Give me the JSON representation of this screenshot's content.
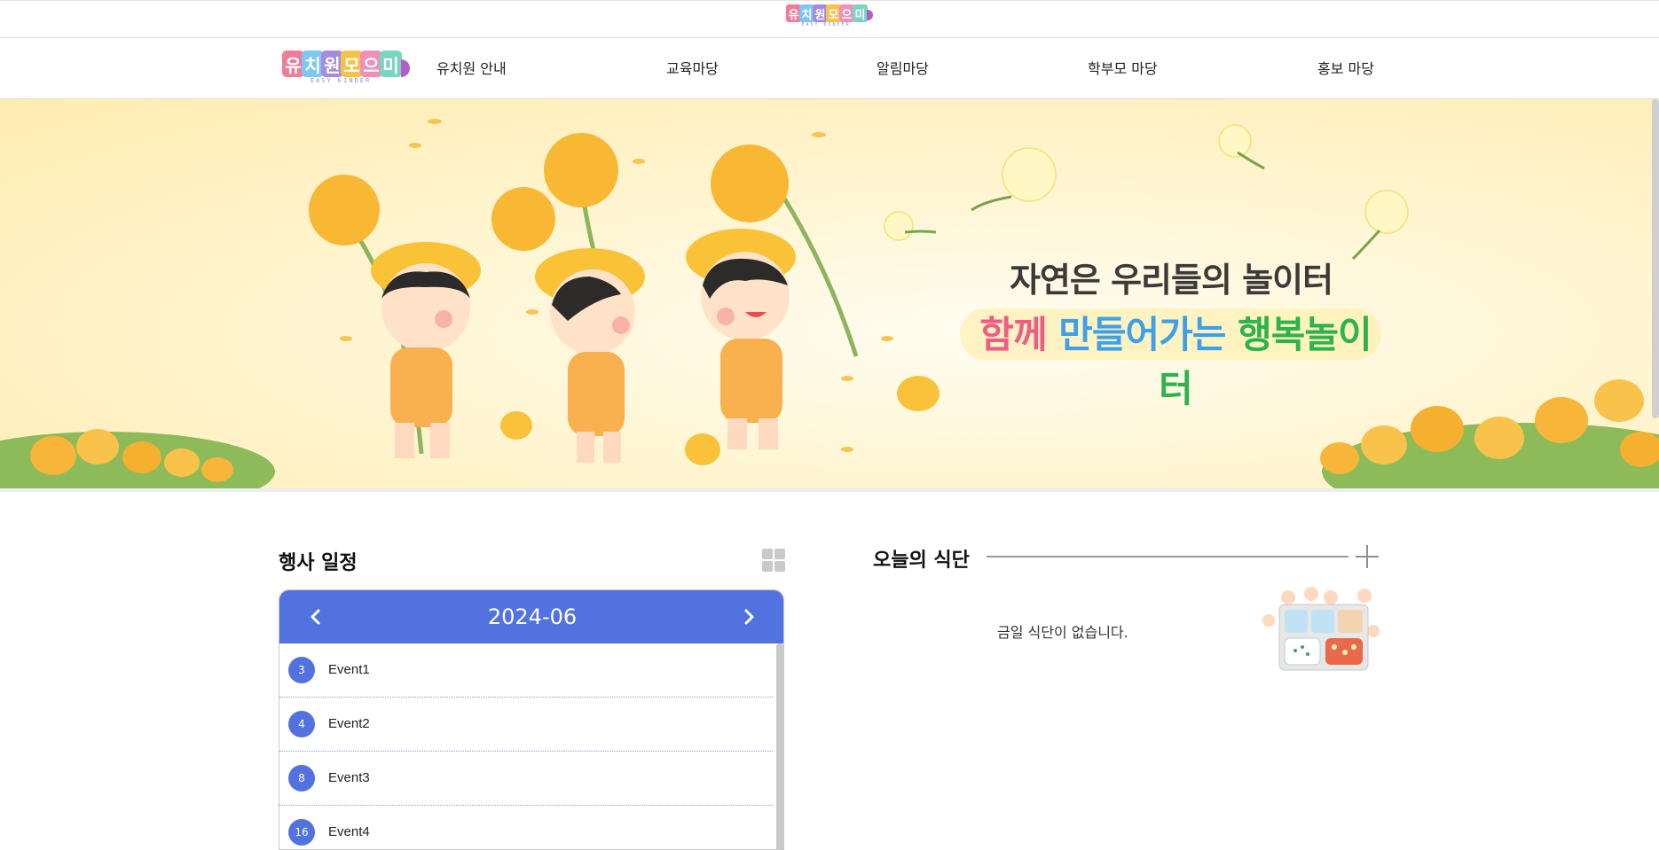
{
  "top_logo": {
    "letters": [
      "유",
      "치",
      "원",
      "모",
      "으",
      "미"
    ],
    "tile_colors": [
      "#f07c9a",
      "#7ec7f0",
      "#a58be0",
      "#f6c24a",
      "#f08fb8",
      "#79d4c2"
    ],
    "subtitle": "EASY KINDER"
  },
  "nav": {
    "logo": {
      "letters": [
        "유",
        "치",
        "원",
        "모",
        "으",
        "미"
      ],
      "subtitle": "EASY KINDER"
    },
    "items": [
      {
        "label": "유치원 안내"
      },
      {
        "label": "교육마당"
      },
      {
        "label": "알림마당"
      },
      {
        "label": "학부모 마당"
      },
      {
        "label": "홍보 마당"
      }
    ]
  },
  "banner": {
    "title": "자연은 우리들의 놀이터",
    "subtitle_part1": "함께",
    "subtitle_part2": "만들어가는",
    "subtitle_part3": "행복놀이터",
    "colors": {
      "part1": "#f05c84",
      "part2": "#3fa0e8",
      "part3": "#2eb24e"
    }
  },
  "events": {
    "title": "행사 일정",
    "month": "2024-06",
    "items": [
      {
        "day": "3",
        "name": "Event1"
      },
      {
        "day": "4",
        "name": "Event2"
      },
      {
        "day": "8",
        "name": "Event3"
      },
      {
        "day": "16",
        "name": "Event4"
      }
    ],
    "accent": "#5272e0"
  },
  "menu": {
    "title": "오늘의 식단",
    "empty_text": "금일 식단이 없습니다."
  }
}
